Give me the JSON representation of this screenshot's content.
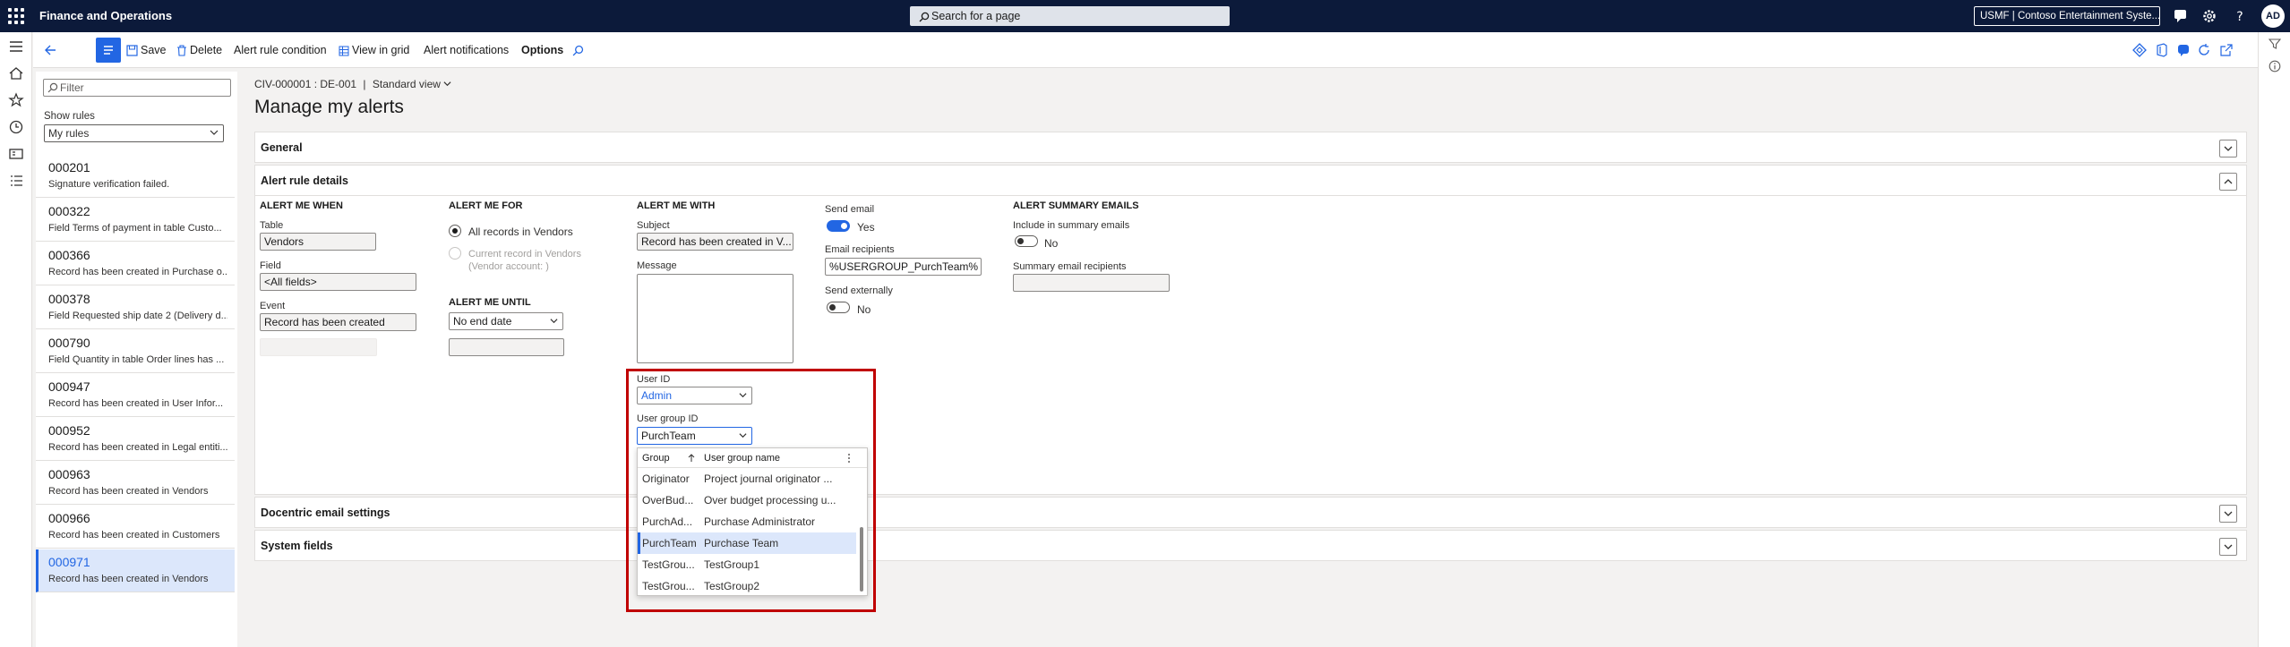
{
  "topbar": {
    "app_title": "Finance and Operations",
    "search_placeholder": "Search for a page",
    "company": "USMF | Contoso Entertainment Syste...",
    "avatar_initials": "AD"
  },
  "actionbar": {
    "save": "Save",
    "delete": "Delete",
    "alert_rule_condition": "Alert rule condition",
    "view_in_grid": "View in grid",
    "alert_notifications": "Alert notifications",
    "options": "Options"
  },
  "sidebar": {
    "filter_placeholder": "Filter",
    "show_rules_label": "Show rules",
    "show_rules_value": "My rules",
    "rules": [
      {
        "id": "000201",
        "desc": "Signature verification failed."
      },
      {
        "id": "000322",
        "desc": "Field Terms of payment in table Custo..."
      },
      {
        "id": "000366",
        "desc": "Record has been created in Purchase o..."
      },
      {
        "id": "000378",
        "desc": "Field Requested ship date 2 (Delivery d..."
      },
      {
        "id": "000790",
        "desc": "Field Quantity in table Order lines has ..."
      },
      {
        "id": "000947",
        "desc": "Record has been created in User Infor..."
      },
      {
        "id": "000952",
        "desc": "Record has been created in Legal entiti..."
      },
      {
        "id": "000963",
        "desc": "Record has been created in Vendors"
      },
      {
        "id": "000966",
        "desc": "Record has been created in Customers"
      },
      {
        "id": "000971",
        "desc": "Record has been created in Vendors"
      }
    ]
  },
  "page": {
    "breadcrumb_record": "CIV-000001 : DE-001",
    "breadcrumb_sep": "|",
    "view": "Standard view",
    "title": "Manage my alerts"
  },
  "fasttabs": {
    "general": "General",
    "alert_rule_details": "Alert rule details",
    "docentric": "Docentric email settings",
    "system_fields": "System fields"
  },
  "alert_me_when": {
    "heading": "ALERT ME WHEN",
    "table_label": "Table",
    "table_value": "Vendors",
    "field_label": "Field",
    "field_value": "<All fields>",
    "event_label": "Event",
    "event_value": "Record has been created"
  },
  "alert_me_for": {
    "heading": "ALERT ME FOR",
    "option_all": "All records in Vendors",
    "option_current": "Current record in Vendors",
    "option_current_sub": "(Vendor account: )"
  },
  "alert_me_until": {
    "heading": "ALERT ME UNTIL",
    "value": "No end date"
  },
  "alert_me_with": {
    "heading": "ALERT ME WITH",
    "subject_label": "Subject",
    "subject_value": "Record has been created in V...",
    "message_label": "Message",
    "user_id_label": "User ID",
    "user_id_value": "Admin",
    "user_group_label": "User group ID",
    "user_group_value": "PurchTeam"
  },
  "email": {
    "send_email_label": "Send email",
    "send_email_value": "Yes",
    "recipients_label": "Email recipients",
    "recipients_value": "%USERGROUP_PurchTeam%",
    "send_external_label": "Send externally",
    "send_external_value": "No"
  },
  "summary": {
    "heading": "ALERT SUMMARY EMAILS",
    "include_label": "Include in summary emails",
    "include_value": "No",
    "recipients_label": "Summary email recipients"
  },
  "group_lookup": {
    "col_group": "Group",
    "col_name": "User group name",
    "rows": [
      {
        "group": "Originator",
        "name": "Project journal originator ..."
      },
      {
        "group": "OverBud...",
        "name": "Over budget processing u..."
      },
      {
        "group": "PurchAd...",
        "name": "Purchase Administrator"
      },
      {
        "group": "PurchTeam",
        "name": "Purchase Team"
      },
      {
        "group": "TestGrou...",
        "name": "TestGroup1"
      },
      {
        "group": "TestGrou...",
        "name": "TestGroup2"
      }
    ],
    "selected_index": 3
  },
  "colors": {
    "topbar": "#0c1a3a",
    "accent": "#2266e3",
    "highlight": "#c00000",
    "selection": "#dce7fb"
  }
}
